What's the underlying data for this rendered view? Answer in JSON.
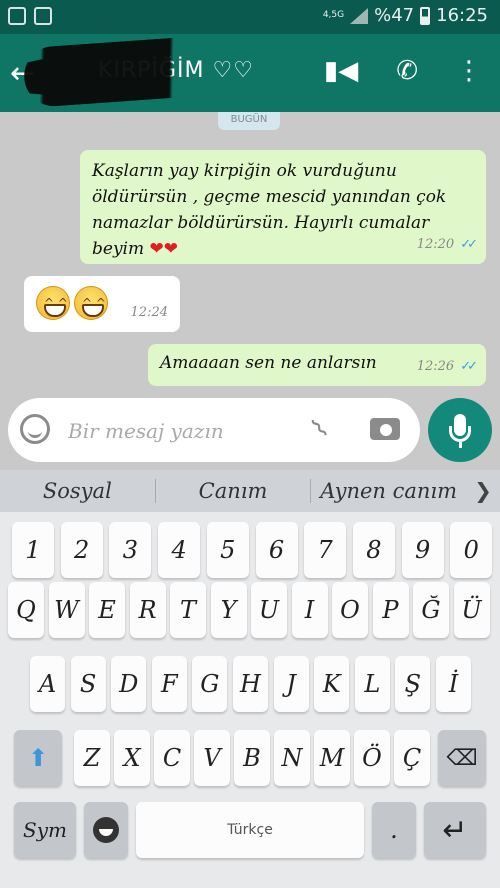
{
  "status_bar": {
    "network": "4,5G",
    "battery_text": "%47",
    "time": "16:25"
  },
  "header": {
    "contact_name": "KIRPİĞİM ♡♡",
    "icons": [
      "back-arrow-icon",
      "video-call-icon",
      "phone-icon",
      "more-vert-icon"
    ]
  },
  "chat": {
    "date_chip": "BUGÜN",
    "messages": [
      {
        "direction": "outgoing",
        "text": "Kaşların yay kirpiğin ok vurduğunu öldürürsün , geçme mescid yanından çok namazlar böldürürsün. Hayırlı cumalar beyim",
        "hearts": "❤❤",
        "time": "12:20",
        "status": "read"
      },
      {
        "direction": "incoming",
        "emoji": "grinning-face-x2",
        "time": "12:24"
      },
      {
        "direction": "outgoing",
        "text": "Amaaaan sen ne anlarsın",
        "time": "12:26",
        "status": "read"
      }
    ]
  },
  "composer": {
    "placeholder": "Bir mesaj yazın"
  },
  "suggestions": [
    "Sosyal",
    "Canım",
    "Aynen canım"
  ],
  "keyboard": {
    "row_numbers": [
      "1",
      "2",
      "3",
      "4",
      "5",
      "6",
      "7",
      "8",
      "9",
      "0"
    ],
    "row1": [
      "Q",
      "W",
      "E",
      "R",
      "T",
      "Y",
      "U",
      "I",
      "O",
      "P",
      "Ğ",
      "Ü"
    ],
    "row2": [
      "A",
      "S",
      "D",
      "F",
      "G",
      "H",
      "J",
      "K",
      "L",
      "Ş",
      "İ"
    ],
    "row3": [
      "Z",
      "X",
      "C",
      "V",
      "B",
      "N",
      "M",
      "Ö",
      "Ç"
    ],
    "sym_label": "Sym",
    "space_label": "Türkçe",
    "period": "."
  },
  "colors": {
    "header": "#0f7666",
    "status_bar": "#0b5a50",
    "outgoing_bubble": "#e0f7c9",
    "read_ticks": "#38a0e8",
    "mic_button": "#12897a"
  }
}
